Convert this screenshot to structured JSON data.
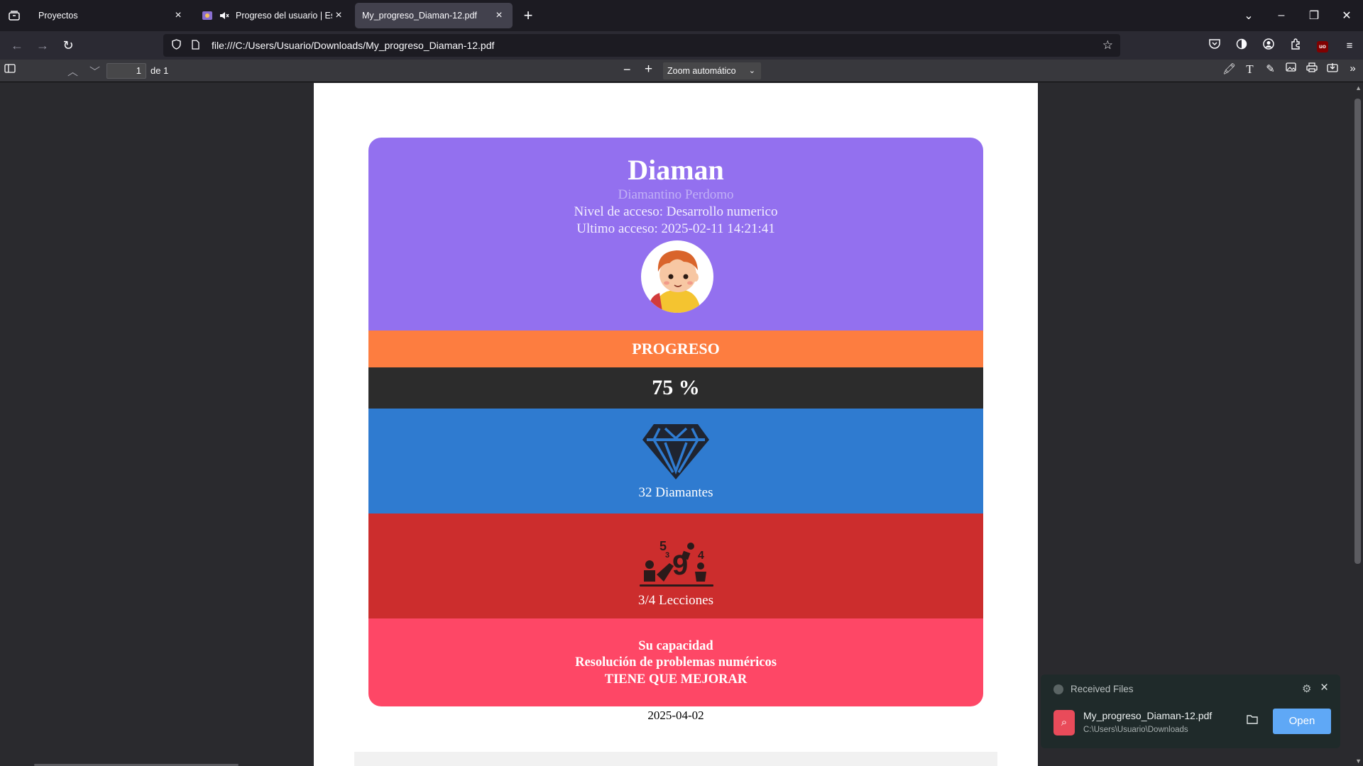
{
  "browser": {
    "tabs": [
      {
        "label": "Proyectos"
      },
      {
        "label": "Progreso del usuario | Espa",
        "muted_icon": "speaker-muted-icon"
      },
      {
        "label": "My_progreso_Diaman-12.pdf"
      }
    ],
    "url": "file:///C:/Users/Usuario/Downloads/My_progreso_Diaman-12.pdf"
  },
  "pdf_toolbar": {
    "page_number": "1",
    "page_count": "de 1",
    "zoom": "Zoom automático"
  },
  "document": {
    "name": "Diaman",
    "full_name": "Diamantino Perdomo",
    "level": "Nivel de acceso: Desarrollo numerico",
    "last_access": "Ultimo acceso: 2025-02-11 14:21:41",
    "progress_label": "PROGRESO",
    "progress_percent": "75 %",
    "diamonds": "32  Diamantes",
    "lessons": "3/4 Lecciones",
    "ability_title": "Su capacidad",
    "ability_skill": "Resolución de problemas numéricos",
    "ability_verdict": "TIENE QUE MEJORAR",
    "date": "2025-04-02",
    "colors": {
      "header": "#9370ef",
      "progress": "#fd7d40",
      "percent": "#2c2c2c",
      "diamonds": "#2f7bd0",
      "lessons": "#cc2d2d",
      "ability": "#fe4766"
    }
  },
  "received_files": {
    "title": "Received Files",
    "file_name": "My_progreso_Diaman-12.pdf",
    "file_path": "C:\\Users\\Usuario\\Downloads",
    "open_label": "Open"
  }
}
